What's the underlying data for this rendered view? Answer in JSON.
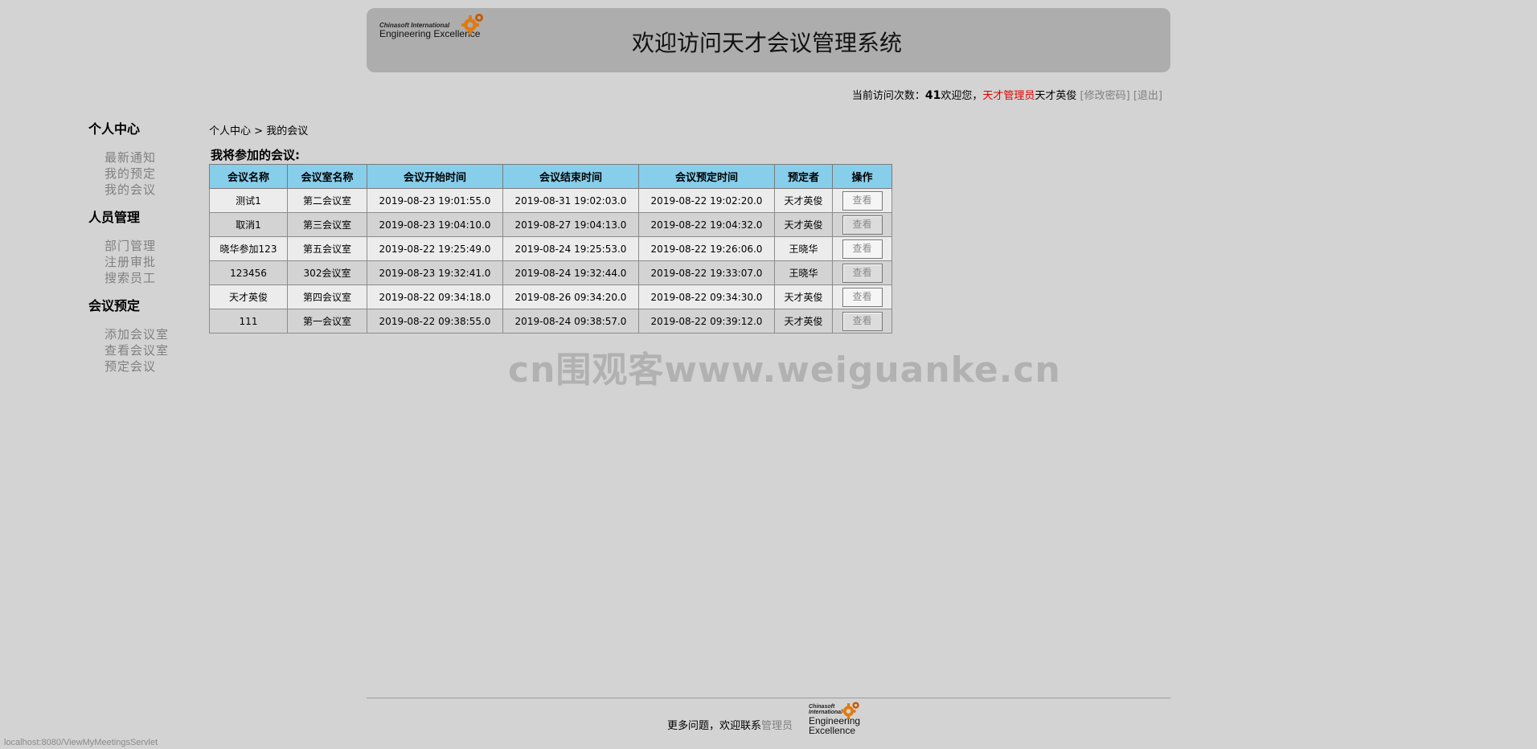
{
  "header": {
    "logo_small": "Chinasoft International",
    "logo_big": "Engineering Excellence",
    "title": "欢迎访问天才会议管理系统"
  },
  "status": {
    "visits_label": "当前访问次数：",
    "visits_count": "41",
    "welcome": "欢迎您，",
    "role": "天才管理员",
    "user": "天才英俊",
    "change_password": "[修改密码]",
    "logout": "[退出]"
  },
  "sidebar": {
    "groups": [
      {
        "heading": "个人中心",
        "items": [
          "最新通知",
          "我的预定",
          "我的会议"
        ]
      },
      {
        "heading": "人员管理",
        "items": [
          "部门管理",
          "注册审批",
          "搜索员工"
        ]
      },
      {
        "heading": "会议预定",
        "items": [
          "添加会议室",
          "查看会议室",
          "预定会议"
        ]
      }
    ]
  },
  "breadcrumb": {
    "root": "个人中心",
    "separator": ">",
    "current": "我的会议"
  },
  "section_title": "我将参加的会议:",
  "table": {
    "headers": [
      "会议名称",
      "会议室名称",
      "会议开始时间",
      "会议结束时间",
      "会议预定时间",
      "预定者",
      "操作"
    ],
    "rows": [
      {
        "name": "测试1",
        "room": "第二会议室",
        "start": "2019-08-23 19:01:55.0",
        "end": "2019-08-31 19:02:03.0",
        "booked": "2019-08-22 19:02:20.0",
        "booker": "天才英俊",
        "action": "查看"
      },
      {
        "name": "取消1",
        "room": "第三会议室",
        "start": "2019-08-23 19:04:10.0",
        "end": "2019-08-27 19:04:13.0",
        "booked": "2019-08-22 19:04:32.0",
        "booker": "天才英俊",
        "action": "查看"
      },
      {
        "name": "晓华参加123",
        "room": "第五会议室",
        "start": "2019-08-22 19:25:49.0",
        "end": "2019-08-24 19:25:53.0",
        "booked": "2019-08-22 19:26:06.0",
        "booker": "王晓华",
        "action": "查看"
      },
      {
        "name": "123456",
        "room": "302会议室",
        "start": "2019-08-23 19:32:41.0",
        "end": "2019-08-24 19:32:44.0",
        "booked": "2019-08-22 19:33:07.0",
        "booker": "王晓华",
        "action": "查看"
      },
      {
        "name": "天才英俊",
        "room": "第四会议室",
        "start": "2019-08-22 09:34:18.0",
        "end": "2019-08-26 09:34:20.0",
        "booked": "2019-08-22 09:34:30.0",
        "booker": "天才英俊",
        "action": "查看"
      },
      {
        "name": "111",
        "room": "第一会议室",
        "start": "2019-08-22 09:38:55.0",
        "end": "2019-08-24 09:38:57.0",
        "booked": "2019-08-22 09:39:12.0",
        "booker": "天才英俊",
        "action": "查看"
      }
    ]
  },
  "watermark": "cn围观客www.weiguanke.cn",
  "footer": {
    "text": "更多问题，欢迎联系",
    "admin_link": "管理员",
    "logo_small": "Chinasoft International",
    "logo_big": "Engineering Excellence"
  },
  "statusbar": "localhost:8080/ViewMyMeetingsServlet",
  "colors": {
    "header_bg": "#87ceeb",
    "role": "#e00000",
    "page_bg": "#d3d3d3"
  },
  "icons": {
    "logo": "gear-icon"
  }
}
